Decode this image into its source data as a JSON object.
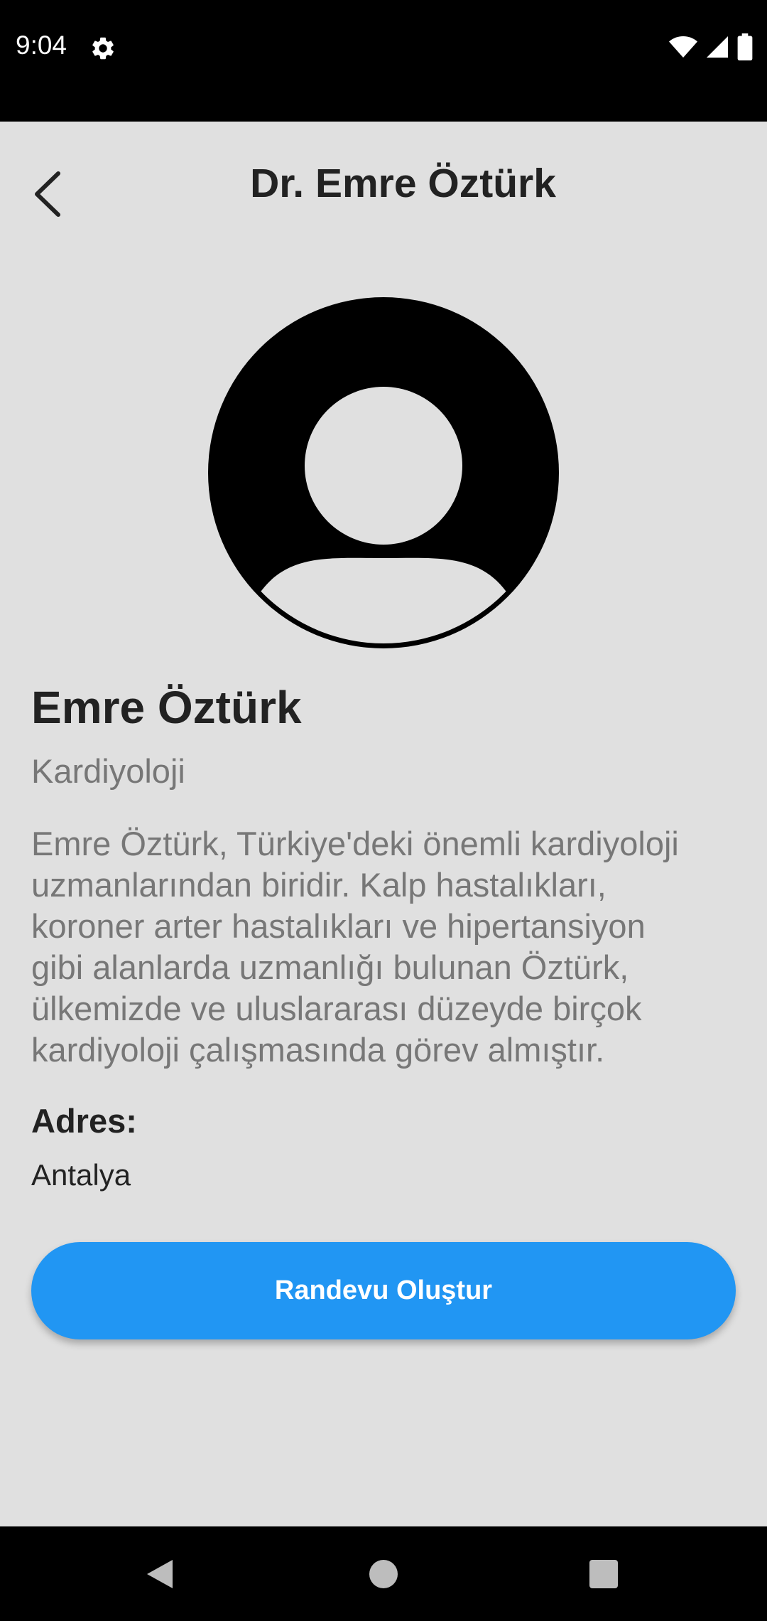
{
  "status_bar": {
    "time": "9:04",
    "icons": [
      "gear-icon",
      "wifi-icon",
      "signal-icon",
      "battery-icon"
    ]
  },
  "header": {
    "title": "Dr. Emre Öztürk",
    "back_icon": "chevron-left-icon"
  },
  "profile": {
    "avatar_icon": "person-avatar-icon",
    "name": "Emre Öztürk",
    "specialty": "Kardiyoloji",
    "bio_lines": [
      "Emre Öztürk, Türkiye'deki önemli kardiyoloji",
      "uzmanlarından biridir. Kalp hastalıkları,",
      "koroner arter hastalıkları ve hipertansiyon",
      "gibi alanlarda uzmanlığı bulunan Öztürk,",
      "ülkemizde ve uluslararası düzeyde birçok",
      "kardiyoloji çalışmasında görev almıştır."
    ],
    "address_label": "Adres:",
    "address_value": "Antalya"
  },
  "actions": {
    "appointment_button": "Randevu Oluştur"
  },
  "nav_bar": {
    "icons": [
      "back-triangle-icon",
      "home-circle-icon",
      "recents-square-icon"
    ]
  },
  "colors": {
    "background": "#e0e0e0",
    "primary": "#2196f3",
    "text_dark": "#222222",
    "text_muted": "#777777"
  }
}
